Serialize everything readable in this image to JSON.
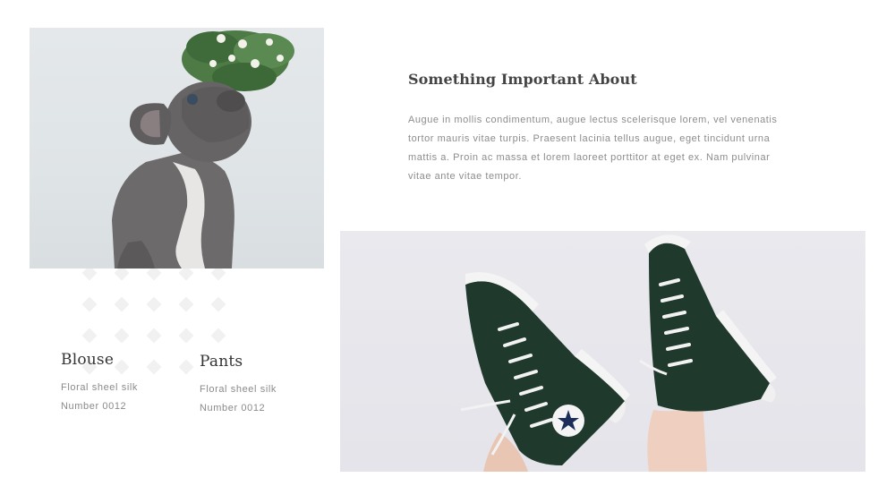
{
  "heading": "Something Important About",
  "paragraph": "Augue in mollis condimentum, augue lectus scelerisque lorem, vel venenatis tortor mauris vitae turpis. Praesent lacinia tellus augue, eget tincidunt urna mattis a. Proin ac massa et lorem laoreet porttitor at eget ex. Nam pulvinar vitae ante vitae tempor.",
  "products": [
    {
      "title": "Blouse",
      "material": "Floral sheel silk",
      "number": "Number 0012"
    },
    {
      "title": "Pants",
      "material": "Floral sheel silk",
      "number": "Number 0012"
    }
  ],
  "images": {
    "left_photo": "french-bulldog-with-mistletoe-photo",
    "right_photo": "black-high-top-sneakers-photo"
  },
  "colors": {
    "background": "#ffffff",
    "heading": "#444444",
    "body_text": "#8c8c8c",
    "diamond": "#f1f1f1"
  }
}
